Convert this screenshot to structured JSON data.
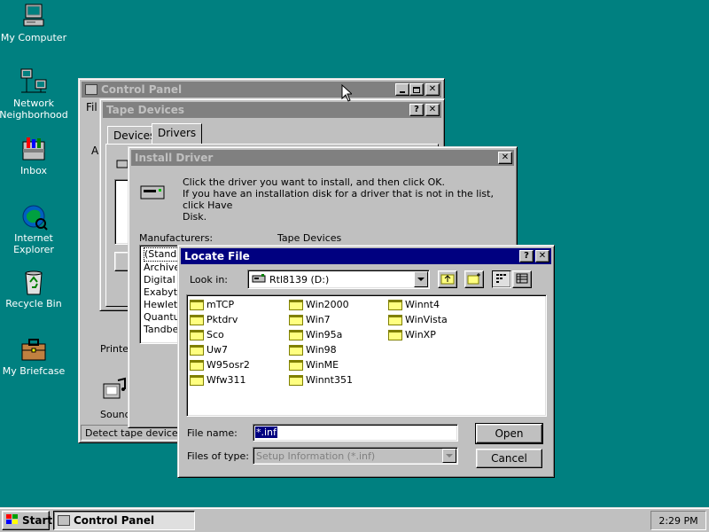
{
  "desktop": {
    "icons": [
      {
        "label": "My Computer"
      },
      {
        "label": "Network Neighborhood"
      },
      {
        "label": "Inbox"
      },
      {
        "label": "Internet Explorer"
      },
      {
        "label": "Recycle Bin"
      },
      {
        "label": "My Briefcase"
      }
    ]
  },
  "control_panel": {
    "title": "Control Panel",
    "menu_fragment": "Fil",
    "left_fragment": "A",
    "item_printers": "Printer",
    "item_sounds": "Sound",
    "status": "Detect tape devices a"
  },
  "tape_devices": {
    "title": "Tape Devices",
    "tabs": [
      {
        "label": "Devices"
      },
      {
        "label": "Drivers"
      }
    ]
  },
  "install_driver": {
    "title": "Install Driver",
    "instruction_line1": "Click the driver you want to install, and then click OK.",
    "instruction_line2": "If you have an installation disk for a driver that is not in the list, click Have",
    "instruction_line3": "Disk.",
    "manufacturers_label": "Manufacturers:",
    "tape_devices_label": "Tape Devices",
    "manufacturers": [
      "(Standa",
      "Archive",
      "Digital",
      "Exabyte",
      "Hewlet",
      "Quantu",
      "Tandbe"
    ]
  },
  "locate_file": {
    "title": "Locate File",
    "look_in_label": "Look in:",
    "look_in_value": "Rtl8139 (D:)",
    "folders_col1": [
      "mTCP",
      "Pktdrv",
      "Sco",
      "Uw7",
      "W95osr2",
      "Wfw311"
    ],
    "folders_col2": [
      "Win2000",
      "Win7",
      "Win95a",
      "Win98",
      "WinME",
      "Winnt351"
    ],
    "folders_col3": [
      "Winnt4",
      "WinVista",
      "WinXP"
    ],
    "file_name_label": "File name:",
    "file_name_value": "*.inf",
    "files_of_type_label": "Files of type:",
    "files_of_type_value": "Setup Information (*.inf)",
    "open_label": "Open",
    "cancel_label": "Cancel"
  },
  "taskbar": {
    "start_label": "Start",
    "task_label": "Control Panel",
    "clock": "2:29 PM"
  },
  "colors": {
    "desktop": "#008080",
    "active_title": "#000080",
    "inactive_title": "#808080",
    "face": "#c0c0c0"
  }
}
